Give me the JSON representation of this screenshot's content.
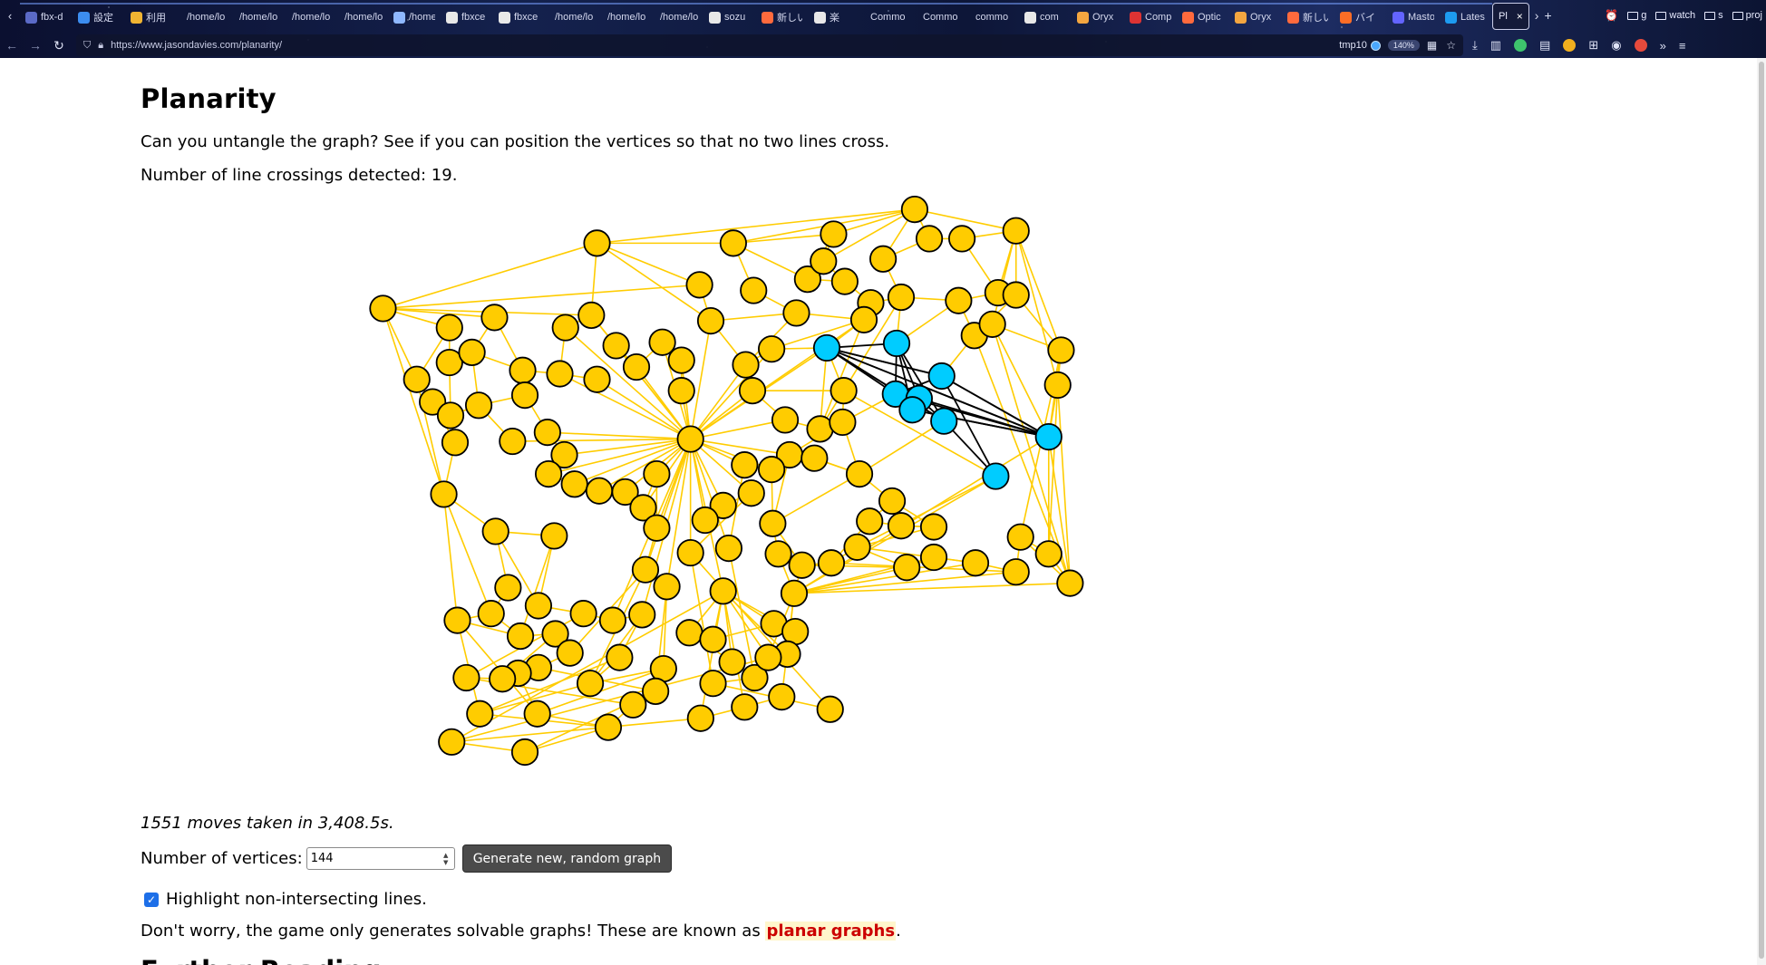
{
  "browser": {
    "tabs": [
      {
        "label": "fbx-d",
        "color": "#5b6ac7"
      },
      {
        "label": "設定",
        "color": "#3c8df0"
      },
      {
        "label": "利用",
        "color": "#f0b432"
      },
      {
        "label": "/home/lo",
        "color": ""
      },
      {
        "label": "/home/lo",
        "color": ""
      },
      {
        "label": "/home/lo",
        "color": ""
      },
      {
        "label": "/home/lo",
        "color": ""
      },
      {
        "label": "/home/lo",
        "color": "#8fb8ff"
      },
      {
        "label": "fbxce",
        "color": "#e8e8e8"
      },
      {
        "label": "fbxce",
        "color": "#e8e8e8"
      },
      {
        "label": "/home/lo",
        "color": ""
      },
      {
        "label": "/home/lo",
        "color": ""
      },
      {
        "label": "/home/lo",
        "color": ""
      },
      {
        "label": "sozu",
        "color": "#e8e8e8"
      },
      {
        "label": "新しい",
        "color": "#ff6a3d"
      },
      {
        "label": "楽",
        "color": "#e8e8e8"
      },
      {
        "label": "Commo",
        "color": ""
      },
      {
        "label": "Commo",
        "color": ""
      },
      {
        "label": "commo",
        "color": ""
      },
      {
        "label": "com",
        "color": "#e8e8e8"
      },
      {
        "label": "Oryx",
        "color": "#f4a640"
      },
      {
        "label": "Comp",
        "color": "#d33"
      },
      {
        "label": "Optic",
        "color": "#ff6a3d"
      },
      {
        "label": "Oryx",
        "color": "#f4a640"
      },
      {
        "label": "新しい",
        "color": "#ff6a3d"
      },
      {
        "label": "バイ",
        "color": "#fc6d26"
      },
      {
        "label": "Masto",
        "color": "#6364ff"
      },
      {
        "label": "Lates",
        "color": "#1d9bf0"
      }
    ],
    "active_tab": {
      "label": "Pl",
      "close": "×"
    },
    "new_tab": "+",
    "bookmarks": [
      "g",
      "watch",
      "s",
      "proj"
    ],
    "url": "https://www.jasondavies.com/planarity/",
    "container": "tmp10",
    "zoom": "140%"
  },
  "page": {
    "title": "Planarity",
    "intro": "Can you untangle the graph? See if you can position the vertices so that no two lines cross.",
    "crossings_prefix": "Number of line crossings detected: ",
    "crossings_count": "19",
    "crossings_suffix": ".",
    "moves": "1551 moves taken in 3,408.5s.",
    "vertices_label": "Number of vertices:",
    "vertices_value": "144",
    "generate_button": "Generate new, random graph",
    "highlight_label": "Highlight non-intersecting lines.",
    "worry_prefix": "Don't worry, the game only generates solvable graphs! These are known as ",
    "worry_link": "planar graphs",
    "worry_suffix": ".",
    "further_heading": "Further Reading"
  },
  "colors": {
    "vertex": "#ffcc00",
    "vertex_selected": "#00ccff",
    "edge_ok": "#ffcc00",
    "edge_crossing": "#000000",
    "link": "#cc0000",
    "button_bg": "#4b4b4b"
  },
  "icons": {
    "back": "back-arrow-icon",
    "forward": "forward-arrow-icon",
    "reload": "reload-icon",
    "shield": "shield-icon",
    "lock": "lock-icon",
    "folder": "folder-icon",
    "checkbox": "checkmark-icon"
  }
}
